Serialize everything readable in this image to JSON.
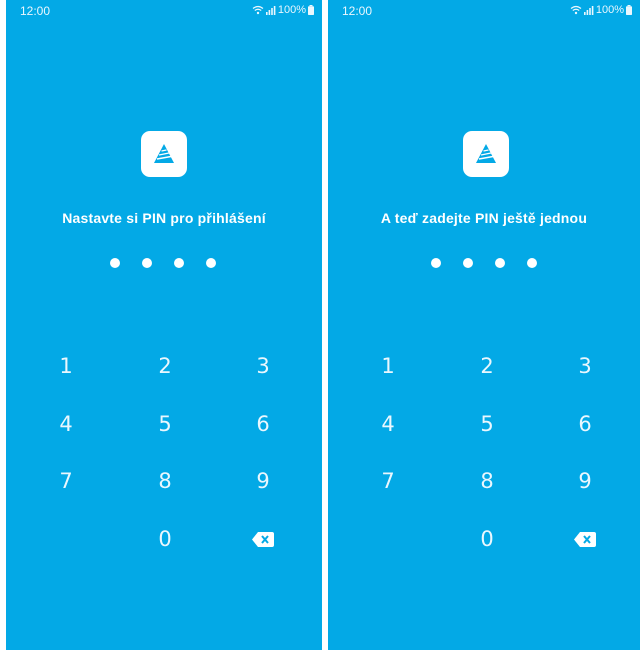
{
  "colors": {
    "background": "#03a9e6",
    "text": "#ffffff",
    "logo_bg": "#ffffff"
  },
  "screens": [
    {
      "status": {
        "time": "12:00",
        "battery": "100%"
      },
      "title": "Nastavte si PIN pro přihlášení",
      "pin_filled": 4,
      "keypad": [
        "1",
        "2",
        "3",
        "4",
        "5",
        "6",
        "7",
        "8",
        "9",
        "0"
      ],
      "backspace_icon": "backspace-icon"
    },
    {
      "status": {
        "time": "12:00",
        "battery": "100%"
      },
      "title": "A teď zadejte PIN ještě jednou",
      "pin_filled": 4,
      "keypad": [
        "1",
        "2",
        "3",
        "4",
        "5",
        "6",
        "7",
        "8",
        "9",
        "0"
      ],
      "backspace_icon": "backspace-icon"
    }
  ]
}
